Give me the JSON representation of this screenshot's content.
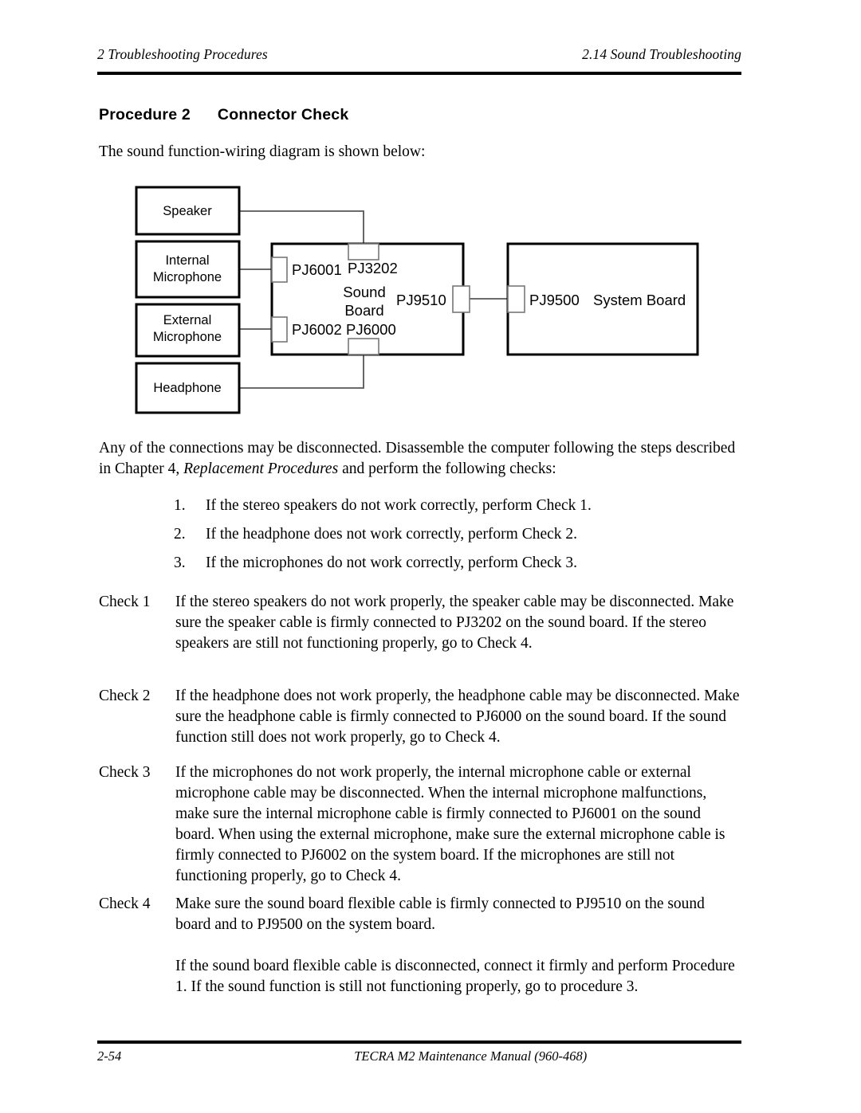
{
  "header": {
    "left": "2  Troubleshooting Procedures",
    "right": "2.14 Sound Troubleshooting"
  },
  "heading": {
    "label": "Procedure 2",
    "title": "Connector Check"
  },
  "intro": "The sound function-wiring diagram is shown below:",
  "diagram": {
    "title": "Sound function-wiring diagram",
    "devices": [
      {
        "name": "speaker",
        "label_line1": "Speaker",
        "label_line2": ""
      },
      {
        "name": "internal-microphone",
        "label_line1": "Internal",
        "label_line2": "Microphone"
      },
      {
        "name": "external-microphone",
        "label_line1": "External",
        "label_line2": "Microphone"
      },
      {
        "name": "headphone",
        "label_line1": "Headphone",
        "label_line2": ""
      }
    ],
    "sound_board": {
      "name_line1": "Sound",
      "name_line2": "Board",
      "connectors": {
        "pj6001": "PJ6001",
        "pj3202": "PJ3202",
        "pj6002": "PJ6002",
        "pj6000": "PJ6000",
        "pj9510": "PJ9510"
      }
    },
    "system_board": {
      "connector": "PJ9500",
      "name": "System Board"
    }
  },
  "lead_paragraph_part1": "Any of the connections may be disconnected. Disassemble the computer following the steps described in Chapter 4, ",
  "lead_paragraph_italic": "Replacement Procedures",
  "lead_paragraph_part2": " and perform the following checks:",
  "numbered_list": [
    {
      "num": "1.",
      "text": "If the stereo speakers do not work correctly, perform Check 1."
    },
    {
      "num": "2.",
      "text": "If the headphone does not work correctly, perform Check 2."
    },
    {
      "num": "3.",
      "text": "If the microphones do not work correctly, perform Check 3."
    }
  ],
  "checks": [
    {
      "label": "Check 1",
      "paragraphs": [
        "If the stereo speakers do not work properly, the speaker cable may be disconnected. Make sure the speaker cable is firmly connected to PJ3202 on the sound board. If the stereo speakers are still not functioning properly, go to Check 4."
      ]
    },
    {
      "label": "Check 2",
      "paragraphs": [
        "If the headphone does not work properly, the headphone cable may be disconnected. Make sure the headphone cable is firmly connected to PJ6000 on the sound board. If the sound function still does not work properly, go to Check 4."
      ]
    },
    {
      "label": "Check 3",
      "paragraphs": [
        "If the microphones do not work properly, the internal microphone cable or external microphone cable may be disconnected. When the internal microphone malfunctions, make sure the internal microphone cable is firmly connected to PJ6001 on the sound board. When using the external microphone, make sure the external microphone cable is firmly connected to PJ6002 on the system board. If the microphones are still not functioning properly, go to Check 4."
      ]
    },
    {
      "label": "Check 4",
      "paragraphs": [
        "Make sure the sound board flexible cable is firmly connected to PJ9510 on the sound board and to PJ9500 on the system board.",
        "If the sound board flexible cable is disconnected, connect it firmly and perform Procedure 1. If the sound function is still not functioning properly, go to procedure 3."
      ]
    }
  ],
  "footer": {
    "page_number": "2-54",
    "manual": "TECRA M2 Maintenance Manual (960-468)"
  },
  "colors": {
    "text": "#000000",
    "wire": "#555555",
    "box_stroke": "#000000",
    "tab_stroke": "#777777",
    "page_bg": "#ffffff"
  }
}
